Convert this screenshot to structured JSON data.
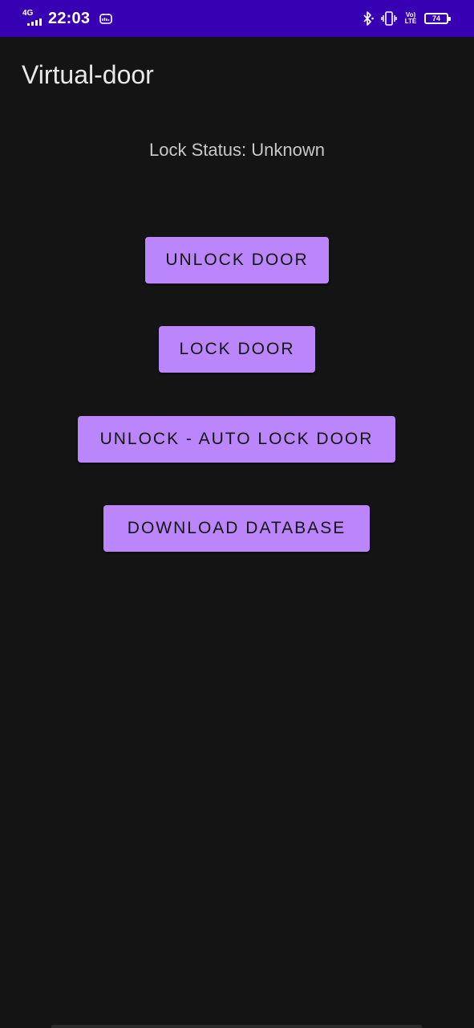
{
  "status_bar": {
    "network_type": "4G",
    "time": "22:03",
    "volte_line1": "Vo)",
    "volte_line2": "LTE",
    "battery_level": "74",
    "icons": [
      "signal-icon",
      "app-notification-icon",
      "bluetooth-icon",
      "vibrate-icon",
      "volte-icon",
      "battery-icon"
    ],
    "background_color": "#3700b3"
  },
  "app_bar": {
    "title": "Virtual-door"
  },
  "main": {
    "lock_status": "Lock Status: Unknown",
    "buttons": {
      "unlock": "UNLOCK DOOR",
      "lock": "LOCK DOOR",
      "auto_lock": "UNLOCK - AUTO LOCK DOOR",
      "download": "DOWNLOAD DATABASE"
    }
  },
  "colors": {
    "background": "#141414",
    "button": "#bb86fc",
    "button_text": "#141414",
    "title_text": "#e8e8e8"
  }
}
